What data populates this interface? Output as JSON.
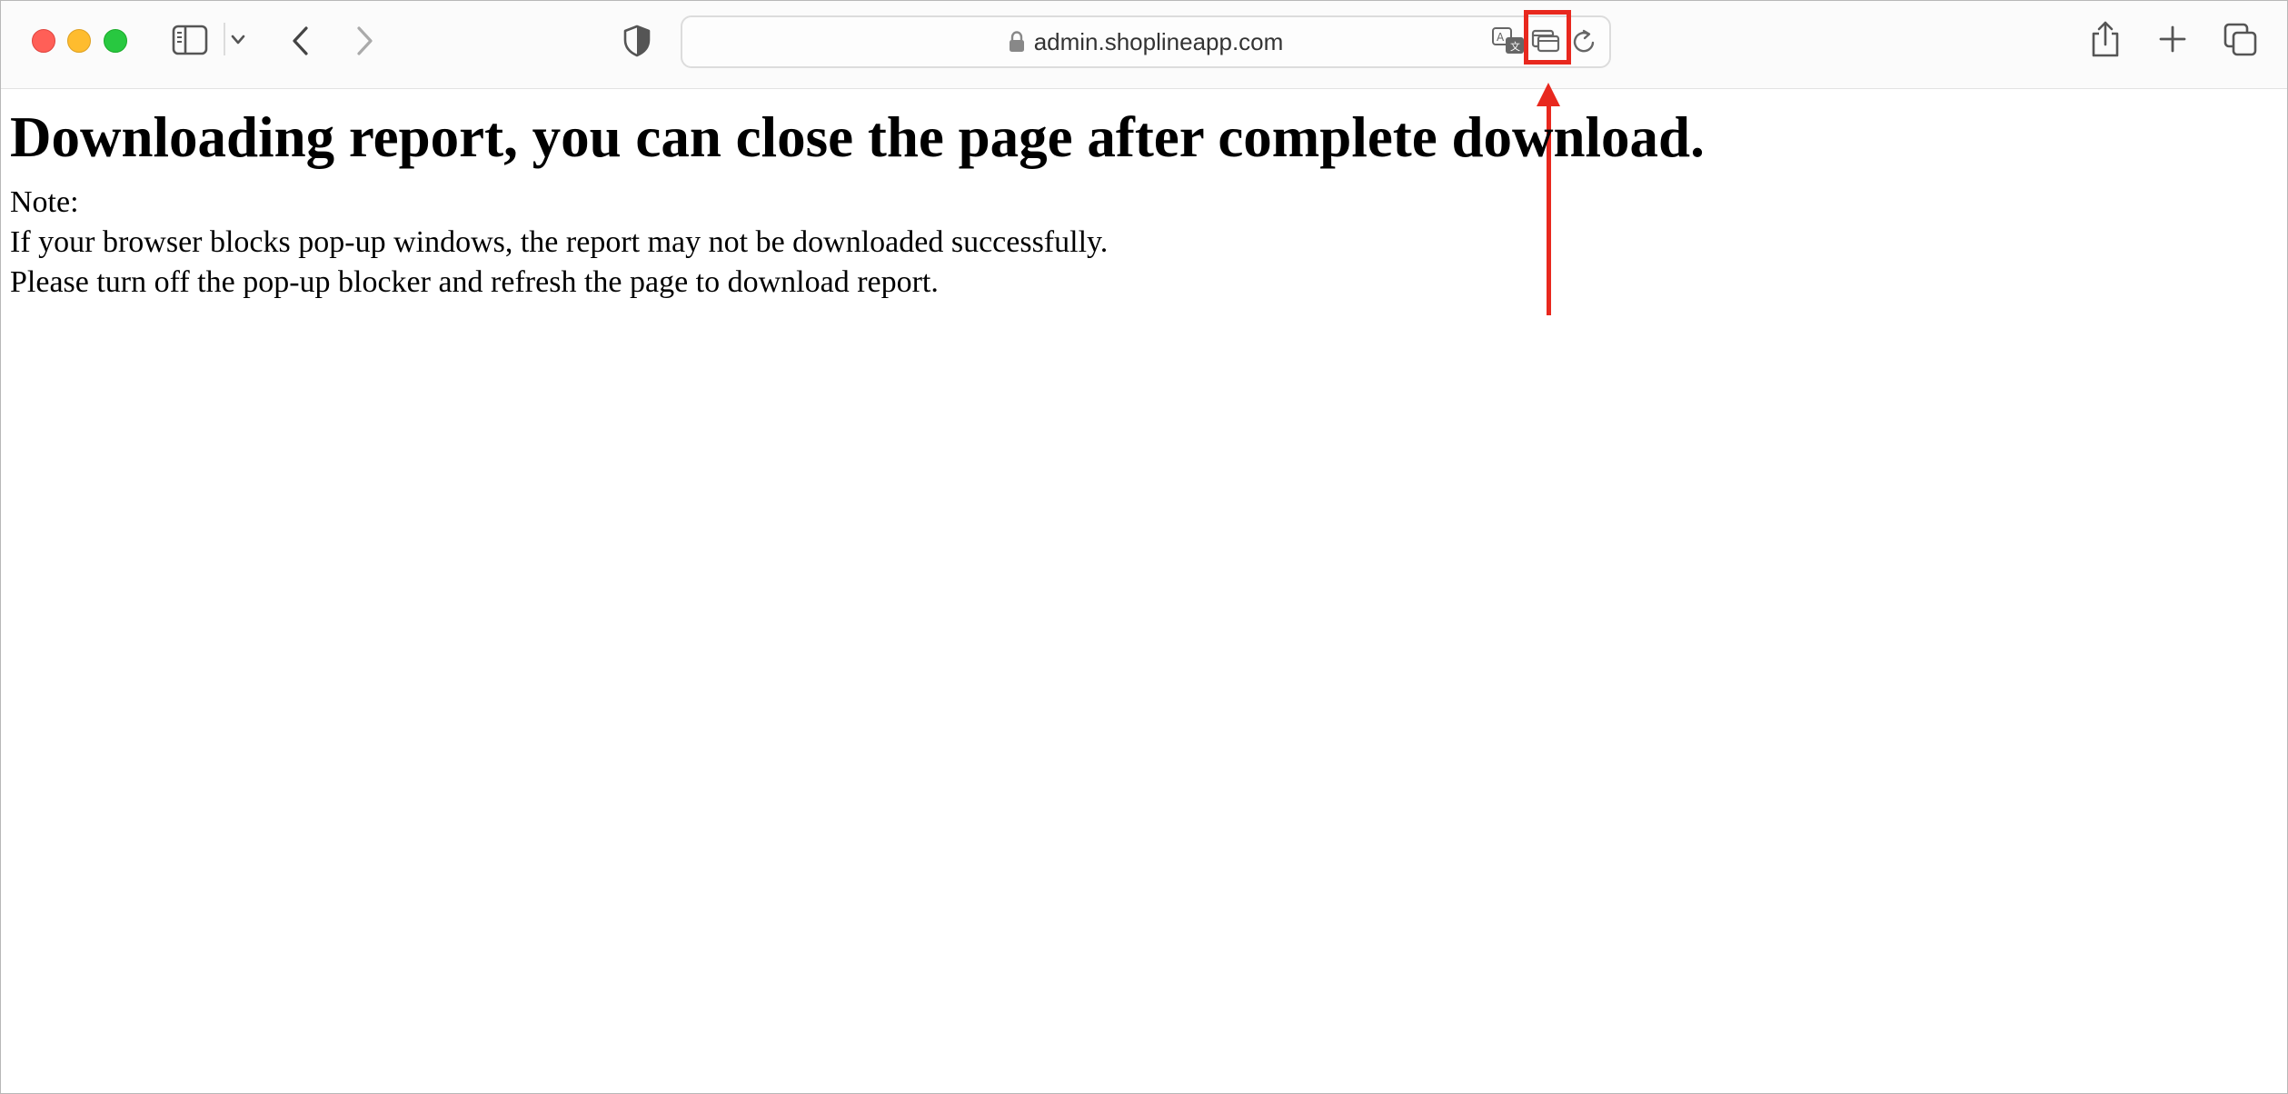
{
  "browser": {
    "url": "admin.shoplineapp.com",
    "icons": {
      "sidebar": "sidebar-icon",
      "chevron": "chevron-down-icon",
      "back": "back-arrow-icon",
      "forward": "forward-arrow-icon",
      "privacy": "shield-icon",
      "lock": "lock-icon",
      "translate": "translate-icon",
      "popup": "popup-blocked-icon",
      "reload": "reload-icon",
      "share": "share-icon",
      "new_tab": "plus-icon",
      "tabs": "tab-overview-icon"
    },
    "colors": {
      "close": "#ff5f57",
      "minimize": "#febc2e",
      "zoom": "#28c840",
      "annotation": "#e8281e"
    }
  },
  "page": {
    "heading": "Downloading report, you can close the page after complete download.",
    "note_label": "Note:",
    "lines": [
      "If your browser blocks pop-up windows, the report may not be downloaded successfully.",
      "Please turn off the pop-up blocker and refresh the page to download report."
    ]
  }
}
